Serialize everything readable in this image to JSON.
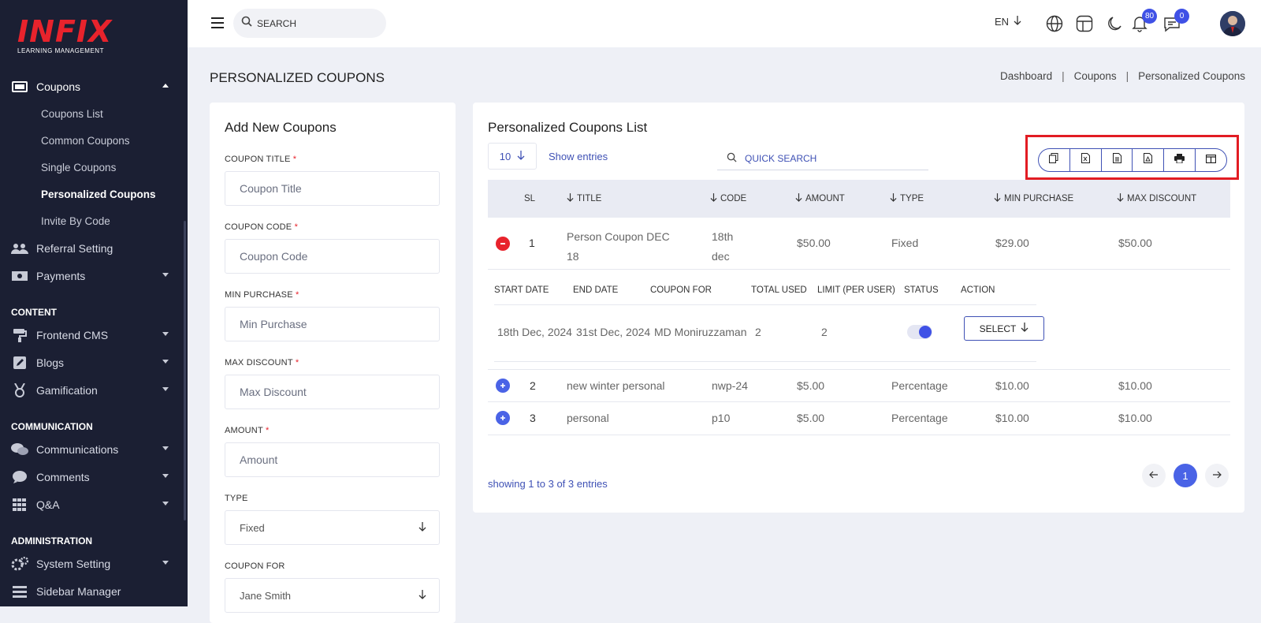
{
  "brand": {
    "logo": "INFIX",
    "tagline": "LEARNING MANAGEMENT"
  },
  "sidebar": {
    "coupons": {
      "label": "Coupons",
      "sub": [
        "Coupons List",
        "Common Coupons",
        "Single Coupons",
        "Personalized Coupons",
        "Invite By Code"
      ]
    },
    "referral": "Referral Setting",
    "payments": "Payments",
    "content_head": "CONTENT",
    "frontend": "Frontend CMS",
    "blogs": "Blogs",
    "gamification": "Gamification",
    "communication_head": "COMMUNICATION",
    "communications": "Communications",
    "comments": "Comments",
    "qa": "Q&A",
    "admin_head": "ADMINISTRATION",
    "system": "System Setting",
    "sidebar_manager": "Sidebar Manager"
  },
  "topbar": {
    "search_placeholder": "SEARCH",
    "lang": "EN",
    "notif_count": "80",
    "msg_count": "0"
  },
  "page": {
    "title": "PERSONALIZED COUPONS",
    "breadcrumb": [
      "Dashboard",
      "Coupons",
      "Personalized Coupons"
    ],
    "sep": "|"
  },
  "form": {
    "title": "Add New Coupons",
    "coupon_title": {
      "label": "COUPON TITLE",
      "placeholder": "Coupon Title"
    },
    "coupon_code": {
      "label": "COUPON CODE",
      "placeholder": "Coupon Code"
    },
    "min_purchase": {
      "label": "MIN PURCHASE",
      "placeholder": "Min Purchase"
    },
    "max_discount": {
      "label": "MAX DISCOUNT",
      "placeholder": "Max Discount"
    },
    "amount": {
      "label": "AMOUNT",
      "placeholder": "Amount"
    },
    "type": {
      "label": "TYPE",
      "value": "Fixed"
    },
    "coupon_for": {
      "label": "COUPON FOR",
      "value": "Jane Smith"
    },
    "req": "*"
  },
  "list": {
    "title": "Personalized Coupons List",
    "page_size": "10",
    "show_entries": "Show entries",
    "quick_search": "QUICK SEARCH",
    "columns": {
      "sl": "SL",
      "title": "TITLE",
      "code": "CODE",
      "amount": "AMOUNT",
      "type": "TYPE",
      "min": "MIN PURCHASE",
      "max": "MAX DISCOUNT"
    },
    "rows": [
      {
        "sl": "1",
        "title": "Person Coupon DEC 18",
        "title_l1": "Person Coupon DEC",
        "title_l2": "18",
        "code_l1": "18th",
        "code_l2": "dec",
        "amount": "$50.00",
        "type": "Fixed",
        "min": "$29.00",
        "max": "$50.00"
      },
      {
        "sl": "2",
        "title": "new winter personal",
        "code": "nwp-24",
        "amount": "$5.00",
        "type": "Percentage",
        "min": "$10.00",
        "max": "$10.00"
      },
      {
        "sl": "3",
        "title": "personal",
        "code": "p10",
        "amount": "$5.00",
        "type": "Percentage",
        "min": "$10.00",
        "max": "$10.00"
      }
    ],
    "detail": {
      "headers": {
        "start": "START DATE",
        "end": "END DATE",
        "for": "COUPON FOR",
        "used": "TOTAL USED",
        "limit": "LIMIT (PER USER)",
        "status": "STATUS",
        "action": "ACTION"
      },
      "start": "18th Dec, 2024",
      "end": "31st Dec, 2024",
      "for": "MD Moniruzzaman",
      "used": "2",
      "limit": "2",
      "status_on": true,
      "action": "SELECT"
    },
    "footer": "showing 1 to 3 of 3 entries",
    "current_page": "1"
  },
  "colors": {
    "accent": "#3f51b5",
    "brand": "#e8232c",
    "sidebar_bg": "#1b1f33",
    "highlight": "#e21c23"
  }
}
